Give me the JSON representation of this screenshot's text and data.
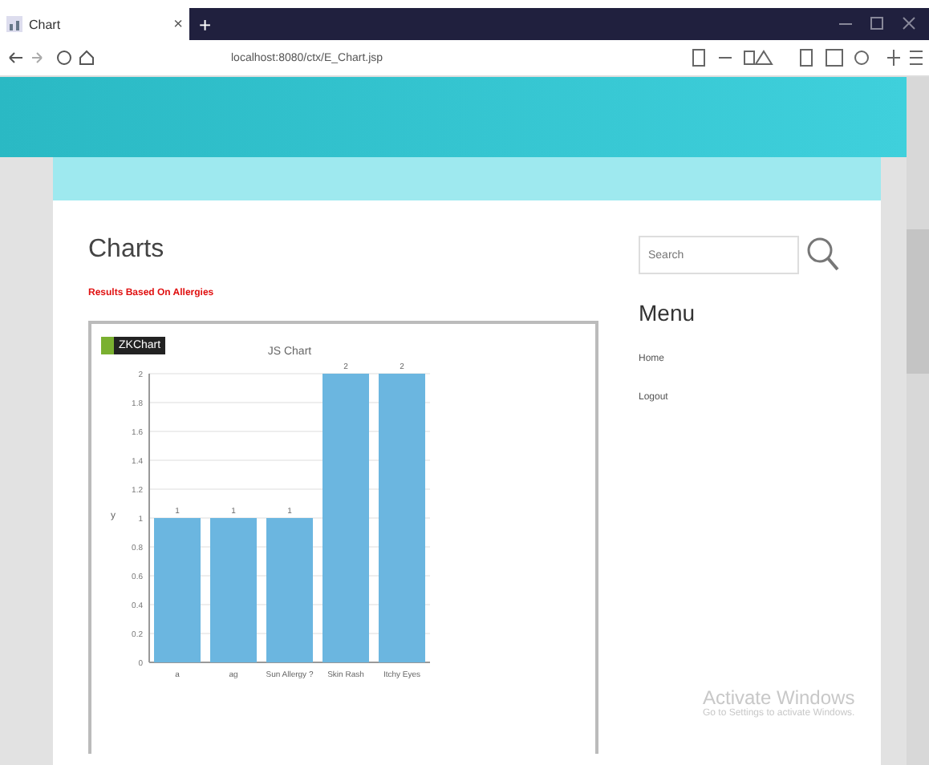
{
  "browser": {
    "tab_title": "Chart",
    "tab_close": "×",
    "new_tab": "+",
    "url": "localhost:8080/ctx/E_Chart.jsp"
  },
  "page": {
    "heading": "Charts",
    "notice": "Results Based On Allergies",
    "chart_logo": "ZKChart",
    "chart_data": {
      "type": "bar",
      "title": "JS Chart",
      "ylabel": "y",
      "categories": [
        "a",
        "ag",
        "Sun Allergy ?",
        "Skin Rash",
        "Itchy Eyes"
      ],
      "values": [
        1,
        1,
        1,
        2,
        2
      ],
      "ylim": [
        0,
        2
      ],
      "yticks": [
        0,
        0.2,
        0.4,
        0.6,
        0.8,
        1,
        1.2,
        1.4,
        1.6,
        1.8,
        2
      ],
      "data_labels": true,
      "grid": true
    }
  },
  "sidebar": {
    "search_placeholder": "Search",
    "menu_title": "Menu",
    "items": [
      {
        "label": "Home"
      },
      {
        "label": "Logout"
      }
    ]
  },
  "os_overlay": {
    "title": "Activate Windows",
    "subtitle": "Go to Settings to activate Windows."
  }
}
